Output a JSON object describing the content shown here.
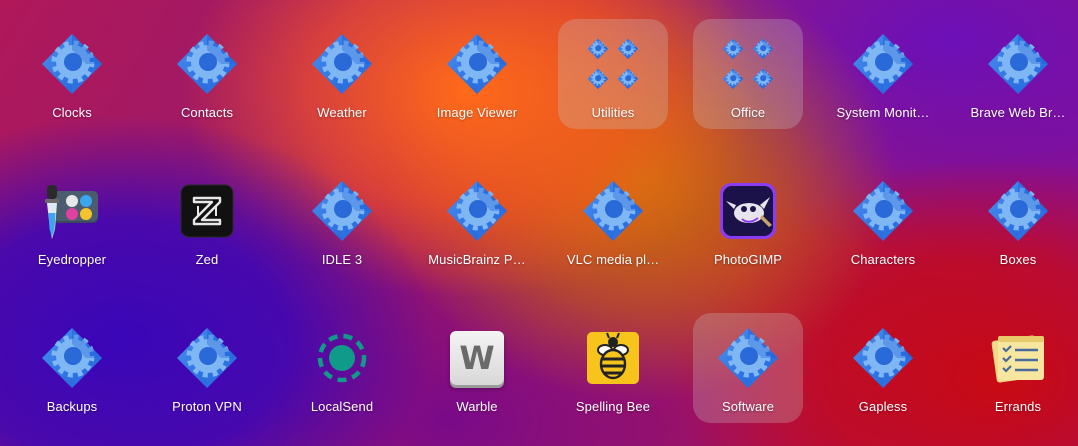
{
  "app_grid": {
    "rows": [
      [
        {
          "label": "Clocks",
          "icon": "generic-app-icon",
          "highlight": false
        },
        {
          "label": "Contacts",
          "icon": "generic-app-icon",
          "highlight": false
        },
        {
          "label": "Weather",
          "icon": "generic-app-icon",
          "highlight": false
        },
        {
          "label": "Image Viewer",
          "icon": "generic-app-icon",
          "highlight": false
        },
        {
          "label": "Utilities",
          "icon": "folder-icon",
          "highlight": true
        },
        {
          "label": "Office",
          "icon": "folder-icon",
          "highlight": true
        },
        {
          "label": "System Monit…",
          "icon": "generic-app-icon",
          "highlight": false
        },
        {
          "label": "Brave Web Br…",
          "icon": "generic-app-icon",
          "highlight": false
        }
      ],
      [
        {
          "label": "Eyedropper",
          "icon": "eyedropper-icon",
          "highlight": false
        },
        {
          "label": "Zed",
          "icon": "zed-icon",
          "highlight": false
        },
        {
          "label": "IDLE 3",
          "icon": "generic-app-icon",
          "highlight": false
        },
        {
          "label": "MusicBrainz P…",
          "icon": "generic-app-icon",
          "highlight": false
        },
        {
          "label": "VLC media pl…",
          "icon": "generic-app-icon",
          "highlight": false
        },
        {
          "label": "PhotoGIMP",
          "icon": "photogimp-icon",
          "highlight": false
        },
        {
          "label": "Characters",
          "icon": "generic-app-icon",
          "highlight": false
        },
        {
          "label": "Boxes",
          "icon": "generic-app-icon",
          "highlight": false
        }
      ],
      [
        {
          "label": "Backups",
          "icon": "generic-app-icon",
          "highlight": false
        },
        {
          "label": "Proton VPN",
          "icon": "generic-app-icon",
          "highlight": false
        },
        {
          "label": "LocalSend",
          "icon": "localsend-icon",
          "highlight": false
        },
        {
          "label": "Warble",
          "icon": "warble-icon",
          "highlight": false
        },
        {
          "label": "Spelling Bee",
          "icon": "bee-icon",
          "highlight": false
        },
        {
          "label": "Software",
          "icon": "generic-app-icon",
          "highlight": true
        },
        {
          "label": "Gapless",
          "icon": "generic-app-icon",
          "highlight": false
        },
        {
          "label": "Errands",
          "icon": "notes-icon",
          "highlight": false
        }
      ]
    ],
    "warble_letter": "W",
    "colors": {
      "generic_blue_dark": "#1c5fd6",
      "generic_blue_light": "#4a90f0",
      "gear": "#5aa0ee",
      "highlight": "rgba(200,200,200,0.28)"
    }
  }
}
